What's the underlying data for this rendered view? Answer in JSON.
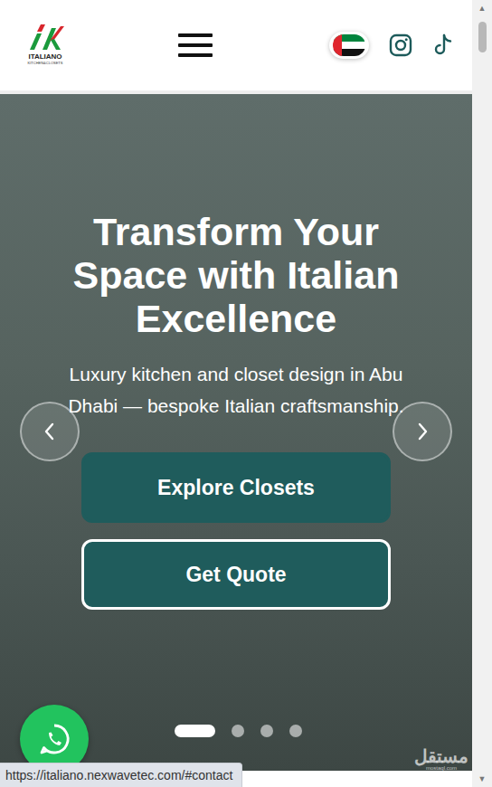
{
  "header": {
    "brand": "ITALIANO",
    "tagline": "KITCHEN&CLOSETS"
  },
  "hero": {
    "title": "Transform Your Space with Italian Excellence",
    "subtitle": "Luxury kitchen and closet design in Abu Dhabi — bespoke Italian craftsmanship.",
    "buttons": [
      {
        "label": "Explore Closets",
        "kind": "filled"
      },
      {
        "label": "Get Quote",
        "kind": "outline"
      }
    ],
    "slides": [
      {
        "selected": true
      },
      {
        "selected": false
      },
      {
        "selected": false
      },
      {
        "selected": false
      }
    ]
  },
  "watermark": {
    "text": "مستقل",
    "site": "mostaql.com"
  },
  "status_bar": {
    "url": "https://italiano.nexwavetec.com/#contact"
  },
  "scrollbar": {
    "up": "▲",
    "down": "▼"
  }
}
